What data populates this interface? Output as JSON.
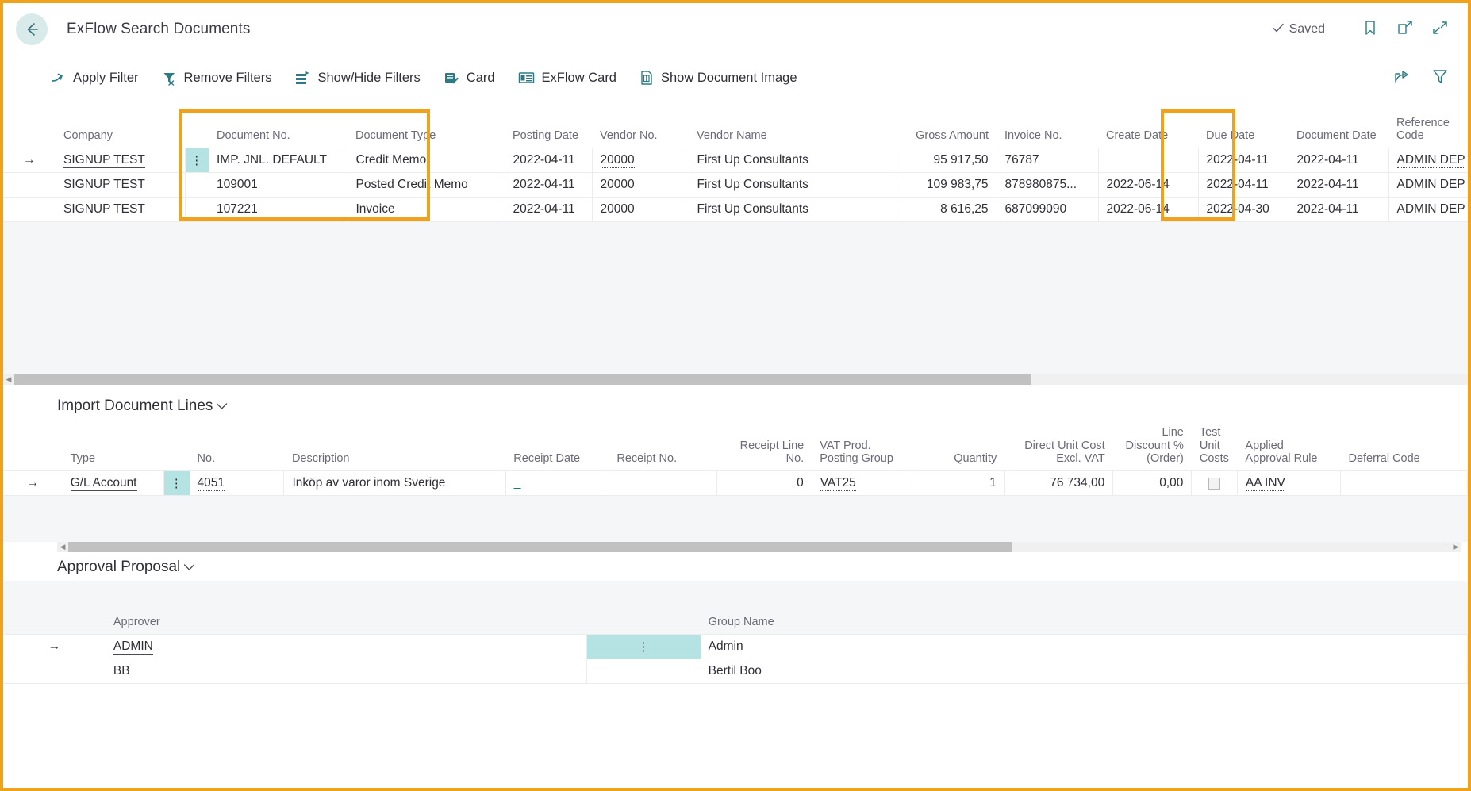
{
  "header": {
    "back_icon": "back-arrow-icon",
    "title": "ExFlow Search Documents",
    "saved_label": "Saved",
    "saved_check_icon": "check-icon",
    "bookmark_icon": "bookmark-icon",
    "open-new-window_icon": "open-in-new-window-icon",
    "collapse_icon": "collapse-icon"
  },
  "commandbar": {
    "items": [
      {
        "label": "Apply Filter",
        "icon": "apply-filter-icon"
      },
      {
        "label": "Remove Filters",
        "icon": "remove-filters-icon"
      },
      {
        "label": "Show/Hide Filters",
        "icon": "show-hide-filters-icon"
      },
      {
        "label": "Card",
        "icon": "card-icon"
      },
      {
        "label": "ExFlow Card",
        "icon": "exflow-card-icon"
      },
      {
        "label": "Show Document Image",
        "icon": "show-document-image-icon"
      }
    ],
    "share_icon": "share-icon",
    "filter_icon": "filter-icon"
  },
  "documents_grid": {
    "columns": [
      "Company",
      "Document No.",
      "Document Type",
      "Posting Date",
      "Vendor No.",
      "Vendor Name",
      "Gross Amount",
      "Invoice No.",
      "Create Date",
      "Due Date",
      "Document Date",
      "Reference Code"
    ],
    "rows": [
      {
        "company": "SIGNUP TEST",
        "document_no": "IMP. JNL. DEFAULT",
        "document_type": "Credit Memo",
        "posting_date": "2022-04-11",
        "vendor_no": "20000",
        "vendor_name": "First Up Consultants",
        "gross_amount": "95 917,50",
        "invoice_no": "76787",
        "create_date": "",
        "due_date": "2022-04-11",
        "document_date": "2022-04-11",
        "reference_code": "ADMIN DEP"
      },
      {
        "company": "SIGNUP TEST",
        "document_no": "109001",
        "document_type": "Posted Credit Memo",
        "posting_date": "2022-04-11",
        "vendor_no": "20000",
        "vendor_name": "First Up Consultants",
        "gross_amount": "109 983,75",
        "invoice_no": "878980875...",
        "create_date": "2022-06-14",
        "due_date": "2022-04-11",
        "document_date": "2022-04-11",
        "reference_code": "ADMIN DEP"
      },
      {
        "company": "SIGNUP TEST",
        "document_no": "107221",
        "document_type": "Invoice",
        "posting_date": "2022-04-11",
        "vendor_no": "20000",
        "vendor_name": "First Up Consultants",
        "gross_amount": "8 616,25",
        "invoice_no": "687099090",
        "create_date": "2022-06-14",
        "due_date": "2022-04-30",
        "document_date": "2022-04-11",
        "reference_code": "ADMIN DEP"
      }
    ]
  },
  "import_lines": {
    "title": "Import Document Lines",
    "columns": [
      "Type",
      "No.",
      "Description",
      "Receipt Date",
      "Receipt No.",
      "Receipt Line No.",
      "VAT Prod. Posting Group",
      "Quantity",
      "Direct Unit Cost Excl. VAT",
      "Line Discount % (Order)",
      "Test Unit Costs",
      "Applied Approval Rule",
      "Deferral Code"
    ],
    "rows": [
      {
        "type": "G/L Account",
        "no": "4051",
        "description": "Inköp av varor inom Sverige",
        "receipt_date": "_",
        "receipt_no": "",
        "receipt_line_no": "0",
        "vat_prod_posting_group": "VAT25",
        "quantity": "1",
        "direct_unit_cost": "76 734,00",
        "line_discount": "0,00",
        "test_unit_costs": false,
        "applied_approval_rule": "AA INV",
        "deferral_code": ""
      }
    ]
  },
  "approval_proposal": {
    "title": "Approval Proposal",
    "columns": [
      "Approver",
      "Group Name"
    ],
    "rows": [
      {
        "approver": "ADMIN",
        "group_name": "Admin"
      },
      {
        "approver": "BB",
        "group_name": "Bertil Boo"
      }
    ]
  },
  "colors": {
    "highlight": "#f0a21b",
    "accent_teal": "#117a84",
    "selection": "#b5e3e3"
  }
}
